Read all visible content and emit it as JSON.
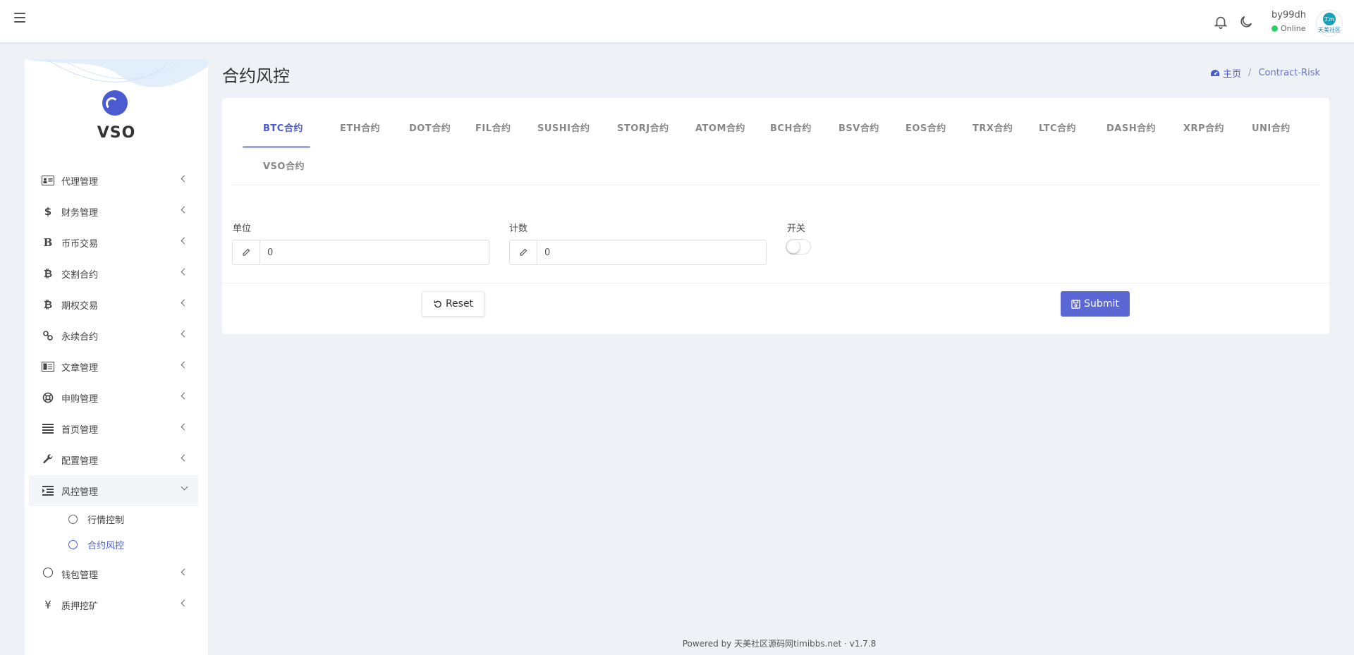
{
  "topbar": {
    "username": "by99dh",
    "status": "Online",
    "avatar_text": "天美社区",
    "avatar_monogram": "T.m"
  },
  "sidebar": {
    "brand": "VSO",
    "items": [
      {
        "label": "代理管理",
        "icon": "id-card-icon"
      },
      {
        "label": "财务管理",
        "icon": "dollar-icon"
      },
      {
        "label": "币币交易",
        "icon": "bold-b-icon"
      },
      {
        "label": "交割合约",
        "icon": "bitcoin-icon"
      },
      {
        "label": "期权交易",
        "icon": "bitcoin-icon"
      },
      {
        "label": "永续合约",
        "icon": "link-icon"
      },
      {
        "label": "文章管理",
        "icon": "newspaper-icon"
      },
      {
        "label": "申购管理",
        "icon": "life-ring-icon"
      },
      {
        "label": "首页管理",
        "icon": "list-icon"
      },
      {
        "label": "配置管理",
        "icon": "wrench-icon"
      },
      {
        "label": "风控管理",
        "icon": "indent-icon"
      },
      {
        "label": "钱包管理",
        "icon": "circle-icon"
      },
      {
        "label": "质押挖矿",
        "icon": "yen-icon"
      }
    ],
    "submenu": [
      {
        "label": "行情控制"
      },
      {
        "label": "合约风控"
      }
    ]
  },
  "page": {
    "title": "合约风控",
    "breadcrumb_home": "主页",
    "breadcrumb_current": "Contract-Risk"
  },
  "tabs": [
    "BTC合约",
    "ETH合约",
    "DOT合约",
    "FIL合约",
    "SUSHI合约",
    "STORJ合约",
    "ATOM合约",
    "BCH合约",
    "BSV合约",
    "EOS合约",
    "TRX合约",
    "LTC合约",
    "DASH合约",
    "XRP合约",
    "UNI合约",
    "VSO合约"
  ],
  "active_tab": "BTC合约",
  "form": {
    "unit_label": "单位",
    "unit_value": "0",
    "count_label": "计数",
    "count_value": "0",
    "switch_label": "开关",
    "switch_on": false,
    "reset_label": "Reset",
    "submit_label": "Submit"
  },
  "footer": {
    "powered": "Powered by 天美社区源码网timibbs.net · v1.7.8"
  },
  "colors": {
    "accent": "#4a5bd1",
    "submit": "#5b67d4",
    "online": "#2ecc71",
    "background": "#eef1f6"
  }
}
